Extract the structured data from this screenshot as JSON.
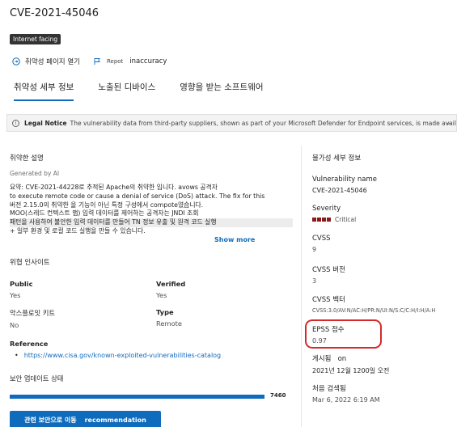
{
  "header": {
    "title": "CVE-2021-45046",
    "badge": "Internet facing"
  },
  "actions": {
    "open_page": "취약성 페이지 열기",
    "report_small": "Repot",
    "report": "inaccuracy"
  },
  "tabs": [
    {
      "label": "취약성 세부 정보"
    },
    {
      "label": "노출된 디바이스"
    },
    {
      "label": "영향을 받는 소프트웨어"
    }
  ],
  "notice": {
    "label": "Legal Notice",
    "text": "The vulnerability data from third-party suppliers, shown as part of your Microsoft Defender for Endpoint services, is made available t..."
  },
  "left": {
    "desc_title": "취약한 설명",
    "generated": "Generated by AI",
    "summary_lines": [
      "요약: CVE-2021-44228로 추적된 Apache의 취약한 입니다. avows 공격자",
      "to execute remote code or cause a denial of service (DoS) attack. The fix for this",
      "버전 2.15.0의 취약한 을 기능이 아닌 특정 구성에서 compote였습니다.",
      "MOO(스레드 컨텍스트 맵) 입력 데이터를 제어하는 공격자는 JNDI 조회",
      "패턴을 사용하여 불안한 입력 데이터를 만들어 TN 정보 유출 및 원격 코드 실행",
      "+ 일부 환경 및 로컬 코드 실행을 만들 수 있습니다."
    ],
    "show_more": "Show more",
    "threat_title": "위협 인사이트",
    "public_label": "Public",
    "public_value": "Yes",
    "verified_label": "Verified",
    "verified_value": "Yes",
    "exploit_label": "악스플로잇 키트",
    "exploit_value": "No",
    "type_label": "Type",
    "type_value": "Remote",
    "reference_label": "Reference",
    "reference_link": "https://www.cisa.gov/known-exploited-vulnerabilities-catalog",
    "update_title": "보안 업데이트 상태",
    "update_value": "7460",
    "update_fraction": 1.0,
    "button_korean": "관련 보안으로 이동",
    "button_english": "recommendation"
  },
  "right": {
    "title": "불가성 세부 정보",
    "vuln_name_label": "Vulnerability name",
    "vuln_name_value": "CVE-2021-45046",
    "severity_label": "Severity",
    "severity_value": "Critical",
    "severity_level": 4,
    "cvss_label": "CVSS",
    "cvss_value": "9",
    "cvss_version_label": "CVSS 버전",
    "cvss_version_value": "3",
    "cvss_vector_label": "CVSS 벡터",
    "cvss_vector_value": "CVSS:3.0/AV:N/AC:H/PR:N/UI:N/S:C/C:H/I:H/A:H",
    "epss_label": "EPSS 점수",
    "epss_value": "0.97",
    "published_label": "게시됨",
    "published_on": "on",
    "published_value": "2021년 12월 1200일 오전",
    "updated_label": "처음 검색됨",
    "updated_value": "Mar 6, 2022 6:19 AM"
  },
  "colors": {
    "accent": "#0f6cbd",
    "severity": "#8b1a1a",
    "highlight_ring": "#d42a2a"
  }
}
